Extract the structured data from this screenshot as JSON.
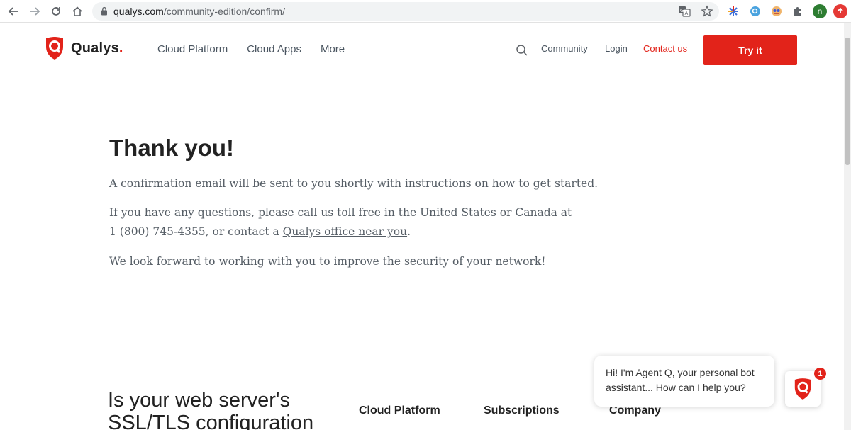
{
  "browser": {
    "url_domain": "qualys.com",
    "url_path": "/community-edition/confirm/",
    "avatar_letter": "n"
  },
  "header": {
    "logo_text": "Qualys",
    "logo_dot": ".",
    "nav": [
      "Cloud Platform",
      "Cloud Apps",
      "More"
    ],
    "community": "Community",
    "login": "Login",
    "contact": "Contact us",
    "try_it": "Try it"
  },
  "main": {
    "title": "Thank you!",
    "p1": "A confirmation email will be sent to you shortly with instructions on how to get started.",
    "p2_line1": "If you have any questions, please call us toll free in the United States or Canada at",
    "p2_line2_pre": "1 (800) 745-4355, or contact a ",
    "p2_link": "Qualys office near you",
    "p2_line2_post": ".",
    "p3": "We look forward to working with you to improve the security of your network!"
  },
  "footer": {
    "ssl_line1": "Is your web server's",
    "ssl_line2": "SSL/TLS configuration",
    "col1": "Cloud Platform",
    "col2": "Subscriptions",
    "col3": "Company"
  },
  "chat": {
    "line1": "Hi! I'm Agent Q, your personal bot",
    "line2": "assistant... How can I help you?",
    "badge": "1"
  },
  "colors": {
    "brand_red": "#e2231a",
    "text_gray": "#555d65"
  }
}
